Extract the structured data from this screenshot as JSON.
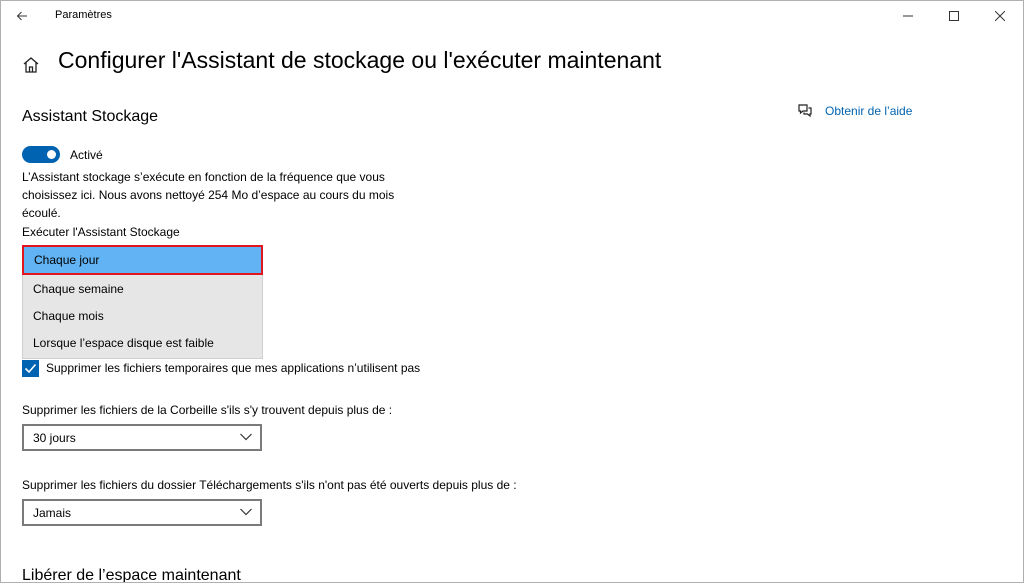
{
  "titlebar": {
    "app_title": "Paramètres",
    "back_icon": "arrow-left-icon",
    "minimize_icon": "minimize-icon",
    "maximize_icon": "maximize-icon",
    "close_icon": "close-icon"
  },
  "header": {
    "home_icon": "home-icon",
    "title": "Configurer l'Assistant de stockage ou l'exécuter maintenant"
  },
  "storage_sense": {
    "section_title": "Assistant Stockage",
    "toggle": {
      "state": "on",
      "label": "Activé"
    },
    "description": "L’Assistant stockage s’exécute en fonction de la fréquence que vous choisissez ici. Nous avons nettoyé 254 Mo d’espace au cours du mois écoulé.",
    "run_label": "Exécuter l'Assistant Stockage",
    "run_options": [
      "Chaque jour",
      "Chaque semaine",
      "Chaque mois",
      "Lorsque l’espace disque est faible"
    ],
    "run_selected": "Chaque jour"
  },
  "temp_files": {
    "checked": true,
    "label": "Supprimer les fichiers temporaires que mes applications n’utilisent pas"
  },
  "recycle_bin": {
    "label": "Supprimer les fichiers de la Corbeille s'ils s'y trouvent depuis plus de :",
    "value": "30 jours"
  },
  "downloads": {
    "label": "Supprimer les fichiers du dossier Téléchargements s'ils n'ont pas été ouverts depuis plus de :",
    "value": "Jamais"
  },
  "free_space": {
    "section_title": "Libérer de l’espace maintenant"
  },
  "help": {
    "icon": "help-chat-icon",
    "link": "Obtenir de l’aide"
  },
  "colors": {
    "accent": "#0063b1",
    "selection": "#62b3f3",
    "highlight_border": "#e2161e",
    "dropdown_bg": "#e6e6e6"
  }
}
